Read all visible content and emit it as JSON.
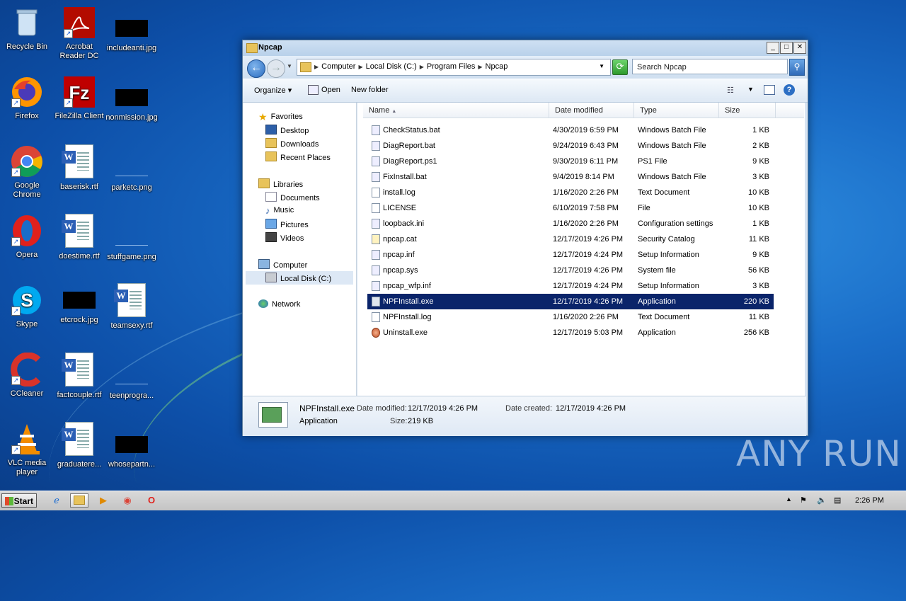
{
  "desktop": {
    "icons": [
      {
        "label": "Recycle Bin"
      },
      {
        "label": "Acrobat Reader DC"
      },
      {
        "label": "includeanti.jpg"
      },
      {
        "label": "Firefox"
      },
      {
        "label": "FileZilla Client"
      },
      {
        "label": "nonmission.jpg"
      },
      {
        "label": "Google Chrome"
      },
      {
        "label": "baserisk.rtf"
      },
      {
        "label": "parketc.png"
      },
      {
        "label": "Opera"
      },
      {
        "label": "doestime.rtf"
      },
      {
        "label": "stuffgame.png"
      },
      {
        "label": "Skype"
      },
      {
        "label": "etcrock.jpg"
      },
      {
        "label": "teamsexy.rtf"
      },
      {
        "label": "CCleaner"
      },
      {
        "label": "factcouple.rtf"
      },
      {
        "label": "teenprogra..."
      },
      {
        "label": "VLC media player"
      },
      {
        "label": "graduatere..."
      },
      {
        "label": "whosepartn..."
      }
    ]
  },
  "window": {
    "title": "Npcap",
    "breadcrumbs": [
      "Computer",
      "Local Disk (C:)",
      "Program Files",
      "Npcap"
    ],
    "search_placeholder": "Search Npcap",
    "toolbar": {
      "organize": "Organize",
      "open": "Open",
      "new_folder": "New folder"
    },
    "nav": {
      "favorites": "Favorites",
      "desktop": "Desktop",
      "downloads": "Downloads",
      "recent": "Recent Places",
      "libraries": "Libraries",
      "documents": "Documents",
      "music": "Music",
      "pictures": "Pictures",
      "videos": "Videos",
      "computer": "Computer",
      "localdisk": "Local Disk (C:)",
      "network": "Network"
    },
    "columns": {
      "name": "Name",
      "date": "Date modified",
      "type": "Type",
      "size": "Size"
    },
    "files": [
      {
        "name": "CheckStatus.bat",
        "date": "4/30/2019 6:59 PM",
        "type": "Windows Batch File",
        "size": "1 KB"
      },
      {
        "name": "DiagReport.bat",
        "date": "9/24/2019 6:43 PM",
        "type": "Windows Batch File",
        "size": "2 KB"
      },
      {
        "name": "DiagReport.ps1",
        "date": "9/30/2019 6:11 PM",
        "type": "PS1 File",
        "size": "9 KB"
      },
      {
        "name": "FixInstall.bat",
        "date": "9/4/2019 8:14 PM",
        "type": "Windows Batch File",
        "size": "3 KB"
      },
      {
        "name": "install.log",
        "date": "1/16/2020 2:26 PM",
        "type": "Text Document",
        "size": "10 KB"
      },
      {
        "name": "LICENSE",
        "date": "6/10/2019 7:58 PM",
        "type": "File",
        "size": "10 KB"
      },
      {
        "name": "loopback.ini",
        "date": "1/16/2020 2:26 PM",
        "type": "Configuration settings",
        "size": "1 KB"
      },
      {
        "name": "npcap.cat",
        "date": "12/17/2019 4:26 PM",
        "type": "Security Catalog",
        "size": "11 KB"
      },
      {
        "name": "npcap.inf",
        "date": "12/17/2019 4:24 PM",
        "type": "Setup Information",
        "size": "9 KB"
      },
      {
        "name": "npcap.sys",
        "date": "12/17/2019 4:26 PM",
        "type": "System file",
        "size": "56 KB"
      },
      {
        "name": "npcap_wfp.inf",
        "date": "12/17/2019 4:24 PM",
        "type": "Setup Information",
        "size": "3 KB"
      },
      {
        "name": "NPFInstall.exe",
        "date": "12/17/2019 4:26 PM",
        "type": "Application",
        "size": "220 KB"
      },
      {
        "name": "NPFInstall.log",
        "date": "1/16/2020 2:26 PM",
        "type": "Text Document",
        "size": "11 KB"
      },
      {
        "name": "Uninstall.exe",
        "date": "12/17/2019 5:03 PM",
        "type": "Application",
        "size": "256 KB"
      }
    ],
    "details": {
      "filename": "NPFInstall.exe",
      "date_modified_label": "Date modified:",
      "date_modified": "12/17/2019 4:26 PM",
      "date_created_label": "Date created:",
      "date_created": "12/17/2019 4:26 PM",
      "type": "Application",
      "size_label": "Size:",
      "size": "219 KB"
    }
  },
  "taskbar": {
    "start": "Start",
    "clock": "2:26 PM"
  },
  "watermark": "ANY RUN"
}
